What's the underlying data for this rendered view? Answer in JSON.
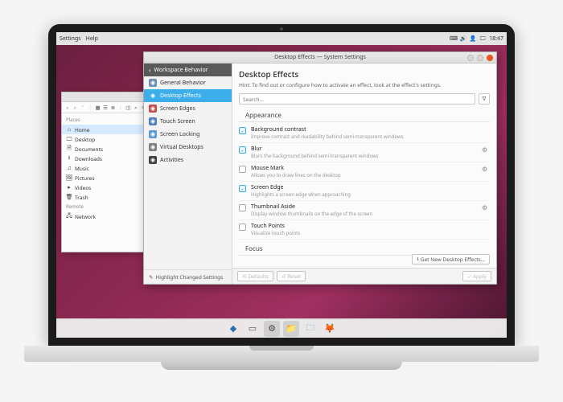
{
  "topbar": {
    "menu": [
      "Settings",
      "Help"
    ],
    "tray_icons": [
      "keyboard-icon",
      "volume-icon",
      "user-icon",
      "display-icon"
    ],
    "clock": "18:47"
  },
  "file_manager": {
    "toolbar_icons": [
      "back-icon",
      "forward-icon",
      "up-icon",
      "divider",
      "icons-view-icon",
      "compact-view-icon",
      "details-view-icon",
      "divider",
      "split-icon",
      "search-icon",
      "menu-icon"
    ],
    "groups": [
      {
        "label": "Places",
        "items": [
          {
            "icon": "home-icon",
            "label": "Home",
            "selected": true
          },
          {
            "icon": "desktop-icon",
            "label": "Desktop"
          },
          {
            "icon": "documents-icon",
            "label": "Documents"
          },
          {
            "icon": "downloads-icon",
            "label": "Downloads"
          },
          {
            "icon": "music-icon",
            "label": "Music"
          },
          {
            "icon": "pictures-icon",
            "label": "Pictures"
          },
          {
            "icon": "videos-icon",
            "label": "Videos"
          },
          {
            "icon": "trash-icon",
            "label": "Trash"
          }
        ]
      },
      {
        "label": "Remote",
        "items": [
          {
            "icon": "network-icon",
            "label": "Network"
          }
        ]
      }
    ]
  },
  "settings": {
    "window_title": "Desktop Effects — System Settings",
    "back_label": "Workspace Behavior",
    "categories": [
      {
        "icon_bg": "#6b8fb3",
        "label": "General Behavior"
      },
      {
        "icon_bg": "#3daee9",
        "label": "Desktop Effects",
        "selected": true
      },
      {
        "icon_bg": "#c0504d",
        "label": "Screen Edges"
      },
      {
        "icon_bg": "#4f81bd",
        "label": "Touch Screen"
      },
      {
        "icon_bg": "#5b9bd5",
        "label": "Screen Locking"
      },
      {
        "icon_bg": "#7f7f7f",
        "label": "Virtual Desktops"
      },
      {
        "icon_bg": "#404040",
        "label": "Activities"
      }
    ],
    "highlight_label": "Highlight Changed Settings",
    "heading": "Desktop Effects",
    "hint": "Hint: To find out or configure how to activate an effect, look at the effect's settings.",
    "search_placeholder": "Search...",
    "sections": [
      {
        "title": "Appearance",
        "effects": [
          {
            "checked": true,
            "name": "Background contrast",
            "desc": "Improve contrast and readability behind semi-transparent windows",
            "configurable": false
          },
          {
            "checked": true,
            "name": "Blur",
            "desc": "Blurs the background behind semi-transparent windows",
            "configurable": true
          },
          {
            "checked": false,
            "name": "Mouse Mark",
            "desc": "Allows you to draw lines on the desktop",
            "configurable": true
          },
          {
            "checked": true,
            "name": "Screen Edge",
            "desc": "Highlights a screen edge when approaching",
            "configurable": false
          },
          {
            "checked": false,
            "name": "Thumbnail Aside",
            "desc": "Display window thumbnails on the edge of the screen",
            "configurable": true
          },
          {
            "checked": false,
            "name": "Touch Points",
            "desc": "Visualize touch points",
            "configurable": false
          }
        ]
      },
      {
        "title": "Focus",
        "effects": []
      }
    ],
    "footer": {
      "get_new": "Get New Desktop Effects...",
      "defaults": "Defaults",
      "reset": "Reset",
      "apply": "Apply"
    }
  },
  "taskbar": {
    "items": [
      {
        "name": "app-launcher-icon",
        "glyph": "◆",
        "color": "#2b6fab"
      },
      {
        "name": "taskbar-show-desktop",
        "glyph": "▭",
        "color": "#555"
      },
      {
        "name": "taskbar-system-settings",
        "glyph": "⚙",
        "color": "#444",
        "active": true
      },
      {
        "name": "taskbar-dolphin",
        "glyph": "📁",
        "color": "#3daee9",
        "active": true
      },
      {
        "name": "taskbar-files",
        "glyph": "🗀",
        "color": "#3daee9"
      },
      {
        "name": "taskbar-firefox",
        "glyph": "🦊",
        "color": "#e66000"
      }
    ]
  }
}
